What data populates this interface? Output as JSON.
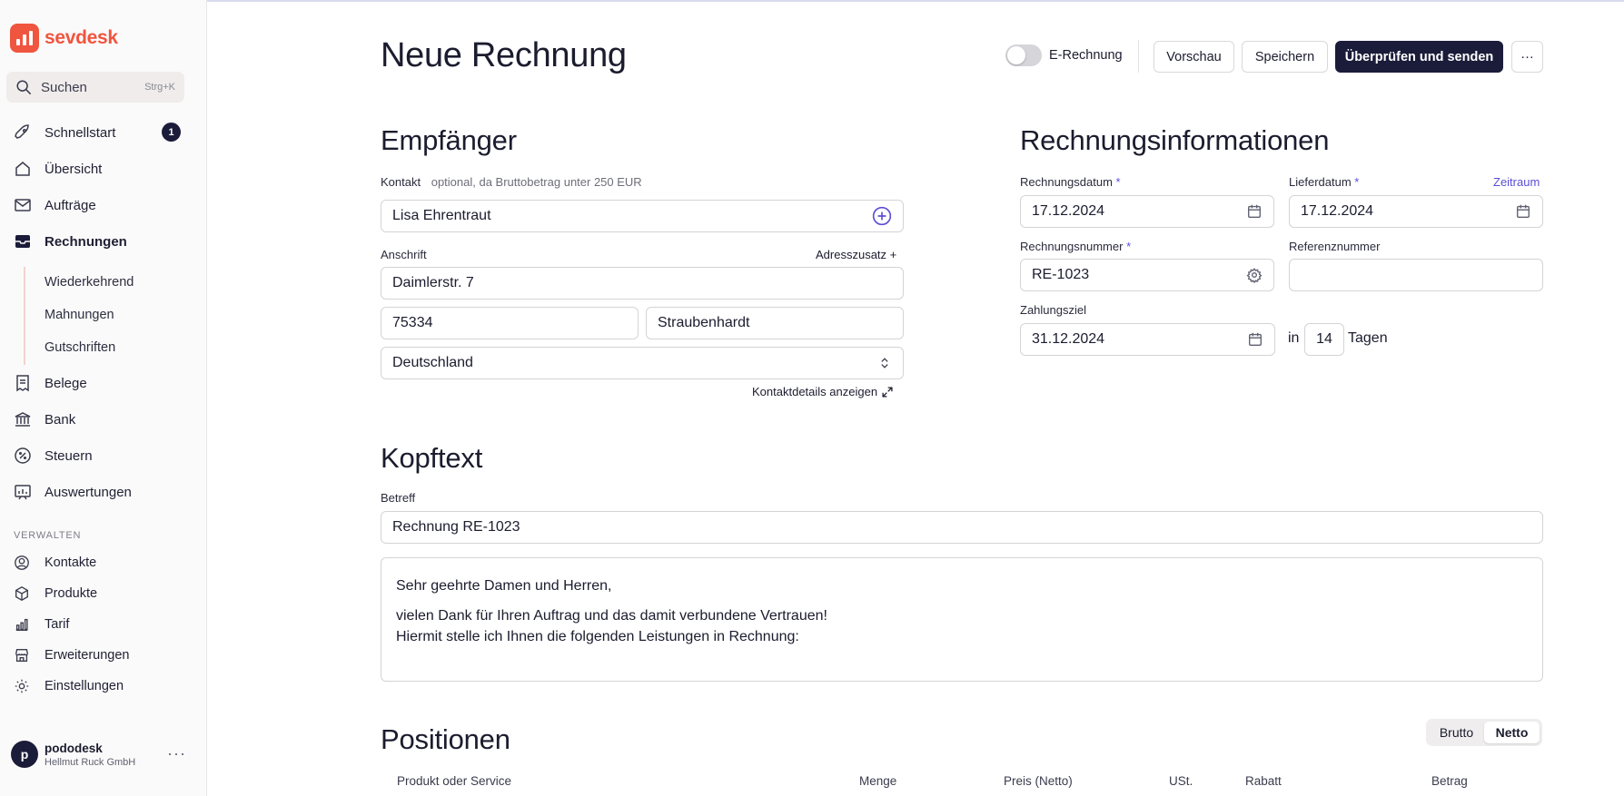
{
  "app": {
    "brand": "sevdesk",
    "accent": "#f0553f",
    "primary": "#1b1c3a",
    "link": "#5a4fd6"
  },
  "sidebar": {
    "search": {
      "label": "Suchen",
      "shortcut": "Strg+K"
    },
    "items": [
      {
        "label": "Schnellstart",
        "icon": "rocket-icon",
        "badge": "1"
      },
      {
        "label": "Übersicht",
        "icon": "home-icon"
      },
      {
        "label": "Aufträge",
        "icon": "mail-icon"
      },
      {
        "label": "Rechnungen",
        "icon": "inbox-icon",
        "active": true
      },
      {
        "label": "Belege",
        "icon": "receipt-icon"
      },
      {
        "label": "Bank",
        "icon": "bank-icon"
      },
      {
        "label": "Steuern",
        "icon": "percent-icon"
      },
      {
        "label": "Auswertungen",
        "icon": "chart-icon"
      }
    ],
    "subitems": [
      "Wiederkehrend",
      "Mahnungen",
      "Gutschriften"
    ],
    "section_label": "VERWALTEN",
    "manage": [
      {
        "label": "Kontakte",
        "icon": "user-circle-icon"
      },
      {
        "label": "Produkte",
        "icon": "box-icon"
      },
      {
        "label": "Tarif",
        "icon": "bars-icon"
      },
      {
        "label": "Erweiterungen",
        "icon": "store-icon"
      },
      {
        "label": "Einstellungen",
        "icon": "gear-icon"
      }
    ],
    "account": {
      "initial": "p",
      "name": "pododesk",
      "company": "Hellmut Ruck GmbH",
      "more": "···"
    }
  },
  "header": {
    "title": "Neue Rechnung",
    "e_invoice_label": "E-Rechnung",
    "e_invoice_on": false,
    "preview": "Vorschau",
    "save": "Speichern",
    "submit": "Überprüfen und senden",
    "more": "···"
  },
  "recipient": {
    "heading": "Empfänger",
    "contact_label": "Kontakt",
    "contact_hint": "optional, da Bruttobetrag unter 250 EUR",
    "contact_value": "Lisa Ehrentraut",
    "address_label": "Anschrift",
    "address_extra": "Adresszusatz +",
    "street": "Daimlerstr. 7",
    "zip": "75334",
    "city": "Straubenhardt",
    "country": "Deutschland",
    "details_link": "Kontaktdetails anzeigen"
  },
  "invoice_info": {
    "heading": "Rechnungsinformationen",
    "date_label": "Rechnungsdatum",
    "date": "17.12.2024",
    "delivery_label": "Lieferdatum",
    "delivery": "17.12.2024",
    "period_link": "Zeitraum",
    "number_label": "Rechnungsnummer",
    "number": "RE-1023",
    "reference_label": "Referenznummer",
    "reference": "",
    "due_label": "Zahlungsziel",
    "due": "31.12.2024",
    "in_label": "in",
    "days": "14",
    "days_label": "Tagen",
    "required_mark": "*"
  },
  "head_text": {
    "heading": "Kopftext",
    "subject_label": "Betreff",
    "subject": "Rechnung RE-1023",
    "greeting": "Sehr geehrte Damen und Herren,",
    "line1": "vielen Dank für Ihren Auftrag und das damit verbundene Vertrauen!",
    "line2": "Hiermit stelle ich Ihnen die folgenden Leistungen in Rechnung:"
  },
  "positions": {
    "heading": "Positionen",
    "toggle": [
      "Brutto",
      "Netto"
    ],
    "selected": "Netto",
    "columns": [
      "Produkt oder Service",
      "Menge",
      "Preis (Netto)",
      "USt.",
      "Rabatt",
      "Betrag"
    ]
  }
}
